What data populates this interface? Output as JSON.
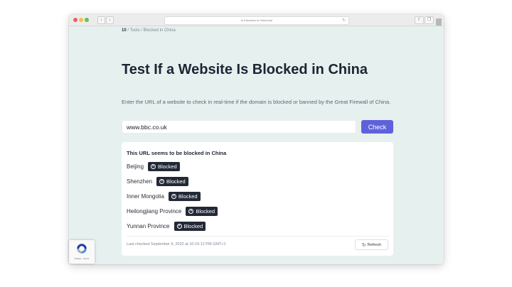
{
  "browser": {
    "address": "is it blocked in China tool"
  },
  "breadcrumb": {
    "home": "10",
    "separator": " / ",
    "tools": "Tools",
    "current": "Blocked in China"
  },
  "page": {
    "title": "Test If a Website Is Blocked in China",
    "description": "Enter the URL of a website to check in real-time if the domain is blocked or banned by the Great Firewall of China."
  },
  "search": {
    "value": "www.bbc.co.uk",
    "button_label": "Check"
  },
  "result": {
    "heading": "This URL seems to be blocked in China",
    "regions": [
      {
        "name": "Beijing",
        "status": "Blocked"
      },
      {
        "name": "Shenzhen",
        "status": "Blocked"
      },
      {
        "name": "Inner Mongolia",
        "status": "Blocked"
      },
      {
        "name": "Heilongjiang Province",
        "status": "Blocked"
      },
      {
        "name": "Yunnan Province",
        "status": "Blocked"
      }
    ],
    "last_checked": "Last checked September 9, 2022 at 10:16:12 PM GMT+1",
    "refresh_label": "Refresh"
  },
  "recaptcha": {
    "links": "Privacy - Terms"
  },
  "colors": {
    "page_background": "#e6f0ef",
    "accent": "#5f61db",
    "badge": "#222836",
    "title_text": "#1d2433"
  },
  "icons": [
    "close-icon",
    "x-circle-icon",
    "refresh-icon",
    "recaptcha-icon",
    "chevron-left-icon",
    "chevron-right-icon"
  ]
}
